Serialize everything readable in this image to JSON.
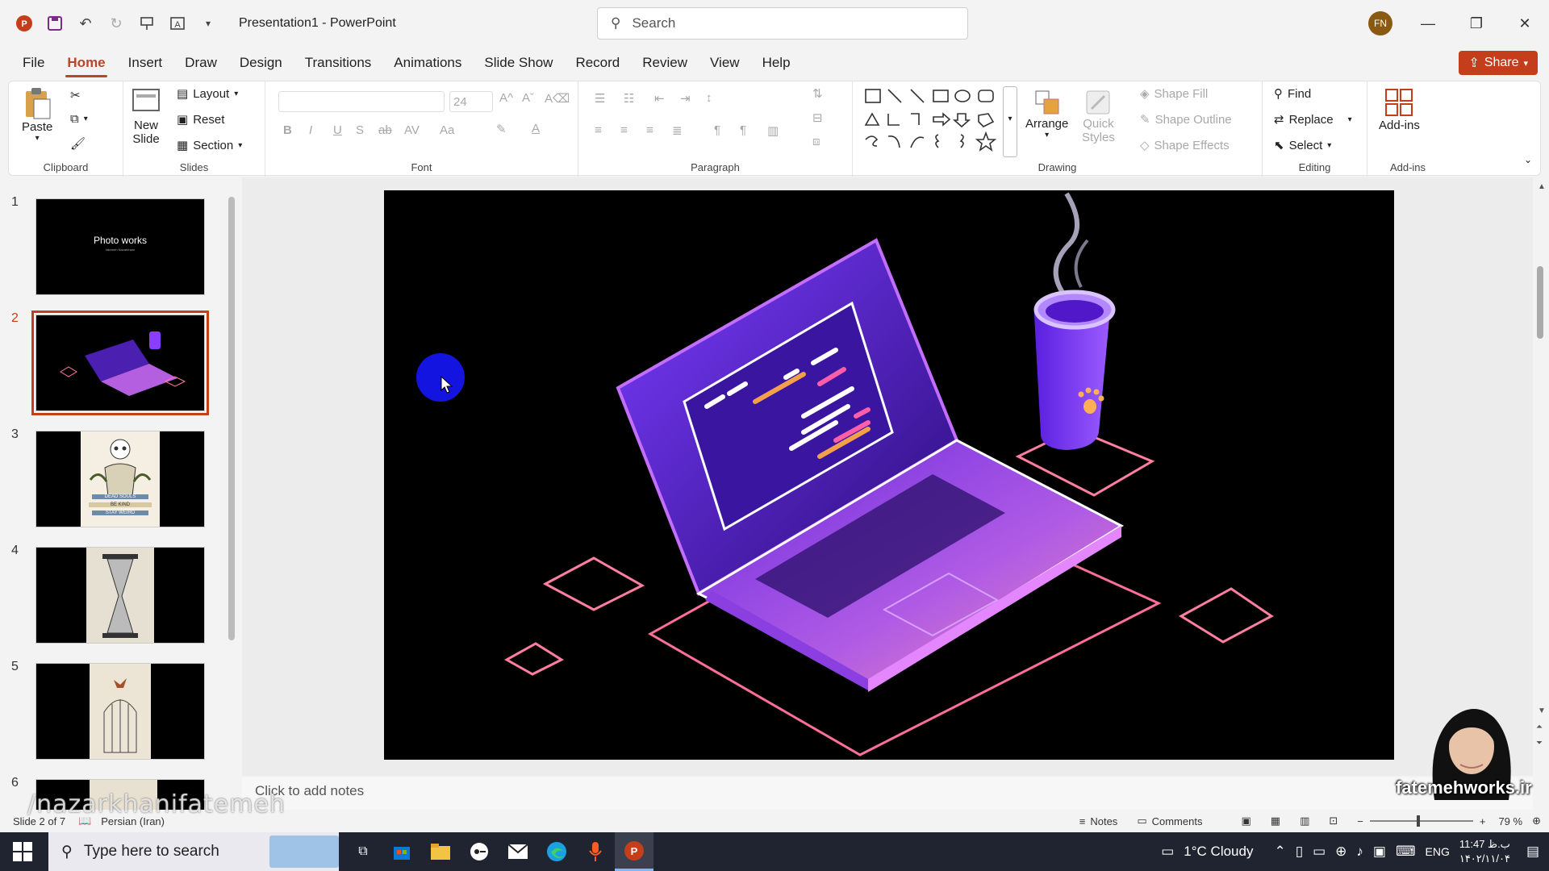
{
  "app": {
    "doc_title": "Presentation1 - PowerPoint",
    "search_placeholder": "Search",
    "user_initials": "FN"
  },
  "tabs": [
    "File",
    "Home",
    "Insert",
    "Draw",
    "Design",
    "Transitions",
    "Animations",
    "Slide Show",
    "Record",
    "Review",
    "View",
    "Help"
  ],
  "active_tab": "Home",
  "share_label": "Share",
  "ribbon": {
    "clipboard": {
      "paste": "Paste",
      "label": "Clipboard"
    },
    "slides": {
      "new_slide_1": "New",
      "new_slide_2": "Slide",
      "layout": "Layout",
      "reset": "Reset",
      "section": "Section",
      "label": "Slides"
    },
    "font": {
      "size": "24",
      "label": "Font"
    },
    "paragraph": {
      "label": "Paragraph"
    },
    "drawing": {
      "arrange": "Arrange",
      "quick_1": "Quick",
      "quick_2": "Styles",
      "shape_fill": "Shape Fill",
      "shape_outline": "Shape Outline",
      "shape_effects": "Shape Effects",
      "label": "Drawing"
    },
    "editing": {
      "find": "Find",
      "replace": "Replace",
      "select": "Select",
      "label": "Editing"
    },
    "addins": {
      "addins": "Add-ins",
      "label": "Add-ins"
    }
  },
  "slides_panel": [
    {
      "num": "1",
      "title": "Photo works",
      "subtitle": "fatemeh Nazarkhani"
    },
    {
      "num": "2"
    },
    {
      "num": "3",
      "book_text_1": "DEAD SOULS",
      "book_text_2": "BE KIND",
      "book_text_3": "STAY WEIRD"
    },
    {
      "num": "4"
    },
    {
      "num": "5"
    },
    {
      "num": "6"
    }
  ],
  "notes_placeholder": "Click to add notes",
  "status": {
    "slide_info": "Slide 2 of 7",
    "language": "Persian (Iran)",
    "notes": "Notes",
    "comments": "Comments",
    "zoom": "79 %"
  },
  "taskbar": {
    "search_placeholder": "Type here to search",
    "weather": "1°C  Cloudy",
    "lang": "ENG",
    "time": "11:47 ب.ظ",
    "date": "۱۴۰۲/۱۱/۰۴"
  },
  "watermarks": {
    "handle": "/nazarkhanifatemeh",
    "site": "fatemehworks.ir"
  },
  "colors": {
    "accent": "#c43e1c",
    "tab_active": "#b7472a",
    "taskbar": "#1f2430"
  }
}
